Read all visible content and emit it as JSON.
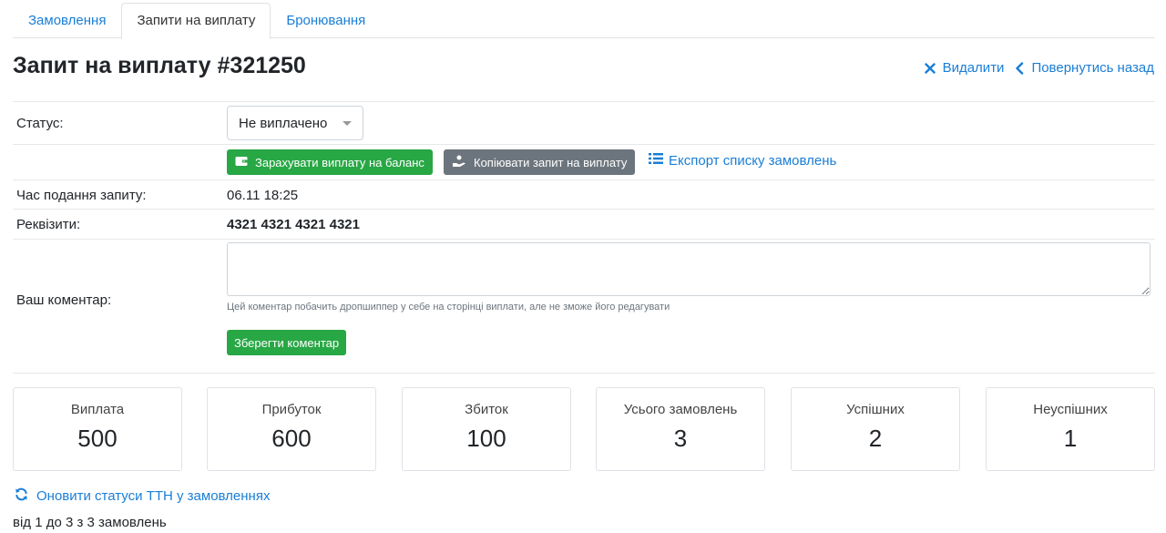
{
  "tabs": [
    {
      "label": "Замовлення"
    },
    {
      "label": "Запити на виплату"
    },
    {
      "label": "Бронювання"
    }
  ],
  "page": {
    "title": "Запит на виплату #321250",
    "delete_label": "Видалити",
    "back_label": "Повернутись назад"
  },
  "status": {
    "label": "Статус:",
    "selected": "Не виплачено"
  },
  "actions": {
    "credit_label": "Зарахувати виплату на баланс",
    "copy_label": "Копіювати запит на виплату",
    "export_label": "Експорт списку замовлень"
  },
  "details": {
    "time_label": "Час подання запиту:",
    "time_value": "06.11 18:25",
    "requisites_label": "Реквізити:",
    "requisites_value": "4321 4321 4321 4321"
  },
  "comment": {
    "label": "Ваш коментар:",
    "hint": "Цей коментар побачить дропшиппер у себе на сторінці виплати, але не зможе його редагувати",
    "save_label": "Зберегти коментар"
  },
  "stats": [
    {
      "label": "Виплата",
      "value": "500"
    },
    {
      "label": "Прибуток",
      "value": "600"
    },
    {
      "label": "Збиток",
      "value": "100"
    },
    {
      "label": "Усього замовлень",
      "value": "3"
    },
    {
      "label": "Успішних",
      "value": "2"
    },
    {
      "label": "Неуспішних",
      "value": "1"
    }
  ],
  "footer": {
    "refresh_label": "Оновити статуси ТТН у замовленнях",
    "count_text": "від 1 до 3 з 3 замовлень"
  },
  "colors": {
    "link": "#1a7ed6",
    "success": "#28a745",
    "secondary": "#6c757d"
  },
  "icons": {
    "delete": "close-icon",
    "back": "chevron-left-icon",
    "credit": "wallet-icon",
    "copy": "hand-coin-icon",
    "export": "list-icon",
    "refresh": "refresh-icon"
  }
}
